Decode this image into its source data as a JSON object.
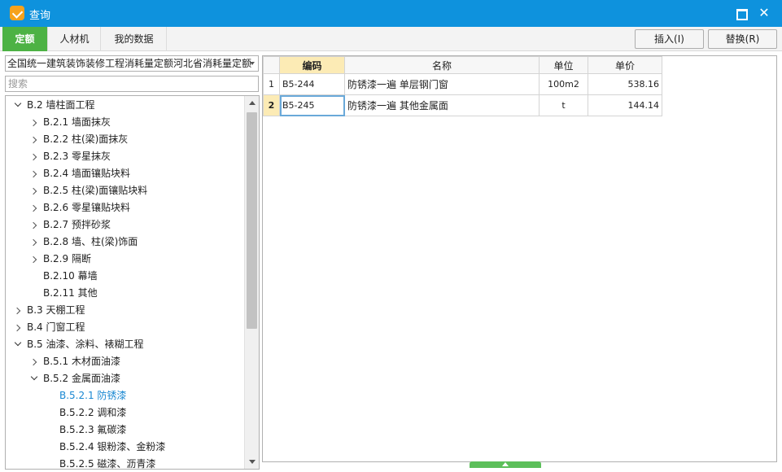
{
  "window": {
    "title": "查询"
  },
  "tabs": [
    {
      "label": "定额"
    },
    {
      "label": "人材机"
    },
    {
      "label": "我的数据"
    }
  ],
  "toolbar": {
    "insert_label": "插入(I)",
    "replace_label": "替换(R)"
  },
  "combo": {
    "value": "全国统一建筑装饰装修工程消耗量定额河北省消耗量定额"
  },
  "search": {
    "placeholder": "搜索"
  },
  "tree": [
    {
      "label": "B.2 墙柱面工程",
      "level": 1,
      "expand": "down"
    },
    {
      "label": "B.2.1 墙面抹灰",
      "level": 2,
      "expand": "right"
    },
    {
      "label": "B.2.2 柱(梁)面抹灰",
      "level": 2,
      "expand": "right"
    },
    {
      "label": "B.2.3 零星抹灰",
      "level": 2,
      "expand": "right"
    },
    {
      "label": "B.2.4 墙面镶贴块料",
      "level": 2,
      "expand": "right"
    },
    {
      "label": "B.2.5 柱(梁)面镶贴块料",
      "level": 2,
      "expand": "right"
    },
    {
      "label": "B.2.6 零星镶贴块料",
      "level": 2,
      "expand": "right"
    },
    {
      "label": "B.2.7 预拌砂浆",
      "level": 2,
      "expand": "right"
    },
    {
      "label": "B.2.8 墙、柱(梁)饰面",
      "level": 2,
      "expand": "right"
    },
    {
      "label": "B.2.9 隔断",
      "level": 2,
      "expand": "right"
    },
    {
      "label": "B.2.10 幕墙",
      "level": 2,
      "expand": "none"
    },
    {
      "label": "B.2.11 其他",
      "level": 2,
      "expand": "none"
    },
    {
      "label": "B.3 天棚工程",
      "level": 1,
      "expand": "right"
    },
    {
      "label": "B.4 门窗工程",
      "level": 1,
      "expand": "right"
    },
    {
      "label": "B.5 油漆、涂料、裱糊工程",
      "level": 1,
      "expand": "down"
    },
    {
      "label": "B.5.1 木材面油漆",
      "level": 2,
      "expand": "right"
    },
    {
      "label": "B.5.2 金属面油漆",
      "level": 2,
      "expand": "down"
    },
    {
      "label": "B.5.2.1 防锈漆",
      "level": 3,
      "expand": "none",
      "selected": true
    },
    {
      "label": "B.5.2.2 调和漆",
      "level": 3,
      "expand": "none"
    },
    {
      "label": "B.5.2.3 氟碳漆",
      "level": 3,
      "expand": "none"
    },
    {
      "label": "B.5.2.4 银粉漆、金粉漆",
      "level": 3,
      "expand": "none"
    },
    {
      "label": "B.5.2.5 磁漆、沥青漆",
      "level": 3,
      "expand": "none"
    }
  ],
  "table": {
    "headers": [
      "编码",
      "名称",
      "单位",
      "单价"
    ],
    "rows": [
      {
        "num": "1",
        "code": "B5-244",
        "name": "防锈漆一遍 单层钢门窗",
        "unit": "100m2",
        "price": "538.16"
      },
      {
        "num": "2",
        "code": "B5-245",
        "name": "防锈漆一遍 其他金属面",
        "unit": "t",
        "price": "144.14"
      }
    ]
  },
  "colors": {
    "title_bar": "#0e92dd",
    "active_tab": "#4db244",
    "header_highlight": "#fcebb5",
    "selected_tree_text": "#1a88d2"
  }
}
